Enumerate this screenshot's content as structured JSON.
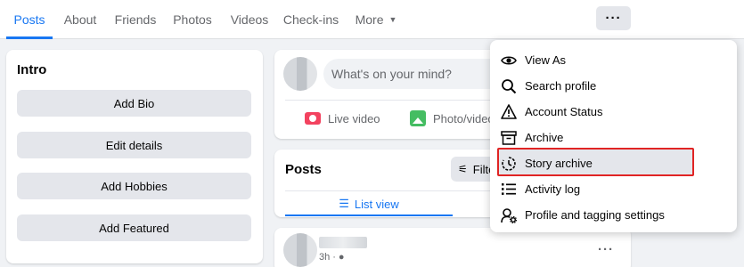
{
  "nav": {
    "tabs": [
      {
        "label": "Posts",
        "active": true
      },
      {
        "label": "About"
      },
      {
        "label": "Friends"
      },
      {
        "label": "Photos"
      },
      {
        "label": "Videos"
      },
      {
        "label": "Check-ins"
      },
      {
        "label": "More"
      }
    ],
    "more_button": "···"
  },
  "intro": {
    "title": "Intro",
    "buttons": [
      "Add Bio",
      "Edit details",
      "Add Hobbies",
      "Add Featured"
    ]
  },
  "composer": {
    "placeholder": "What's on your mind?",
    "actions": [
      "Live video",
      "Photo/video"
    ]
  },
  "posts": {
    "title": "Posts",
    "filter_label": "Filters",
    "list_view_label": "List view"
  },
  "post": {
    "time": "3h",
    "more": "···"
  },
  "menu": {
    "items": [
      {
        "label": "View As",
        "icon": "eye-icon"
      },
      {
        "label": "Search profile",
        "icon": "search-icon"
      },
      {
        "label": "Account Status",
        "icon": "warning-icon"
      },
      {
        "label": "Archive",
        "icon": "archive-icon"
      },
      {
        "label": "Story archive",
        "icon": "story-archive-icon",
        "highlighted": true
      },
      {
        "label": "Activity log",
        "icon": "list-icon"
      },
      {
        "label": "Profile and tagging settings",
        "icon": "profile-gear-icon"
      }
    ]
  },
  "colors": {
    "accent": "#1877f2",
    "highlight_border": "#e02424",
    "live": "#f3425f",
    "photo": "#45bd62"
  }
}
